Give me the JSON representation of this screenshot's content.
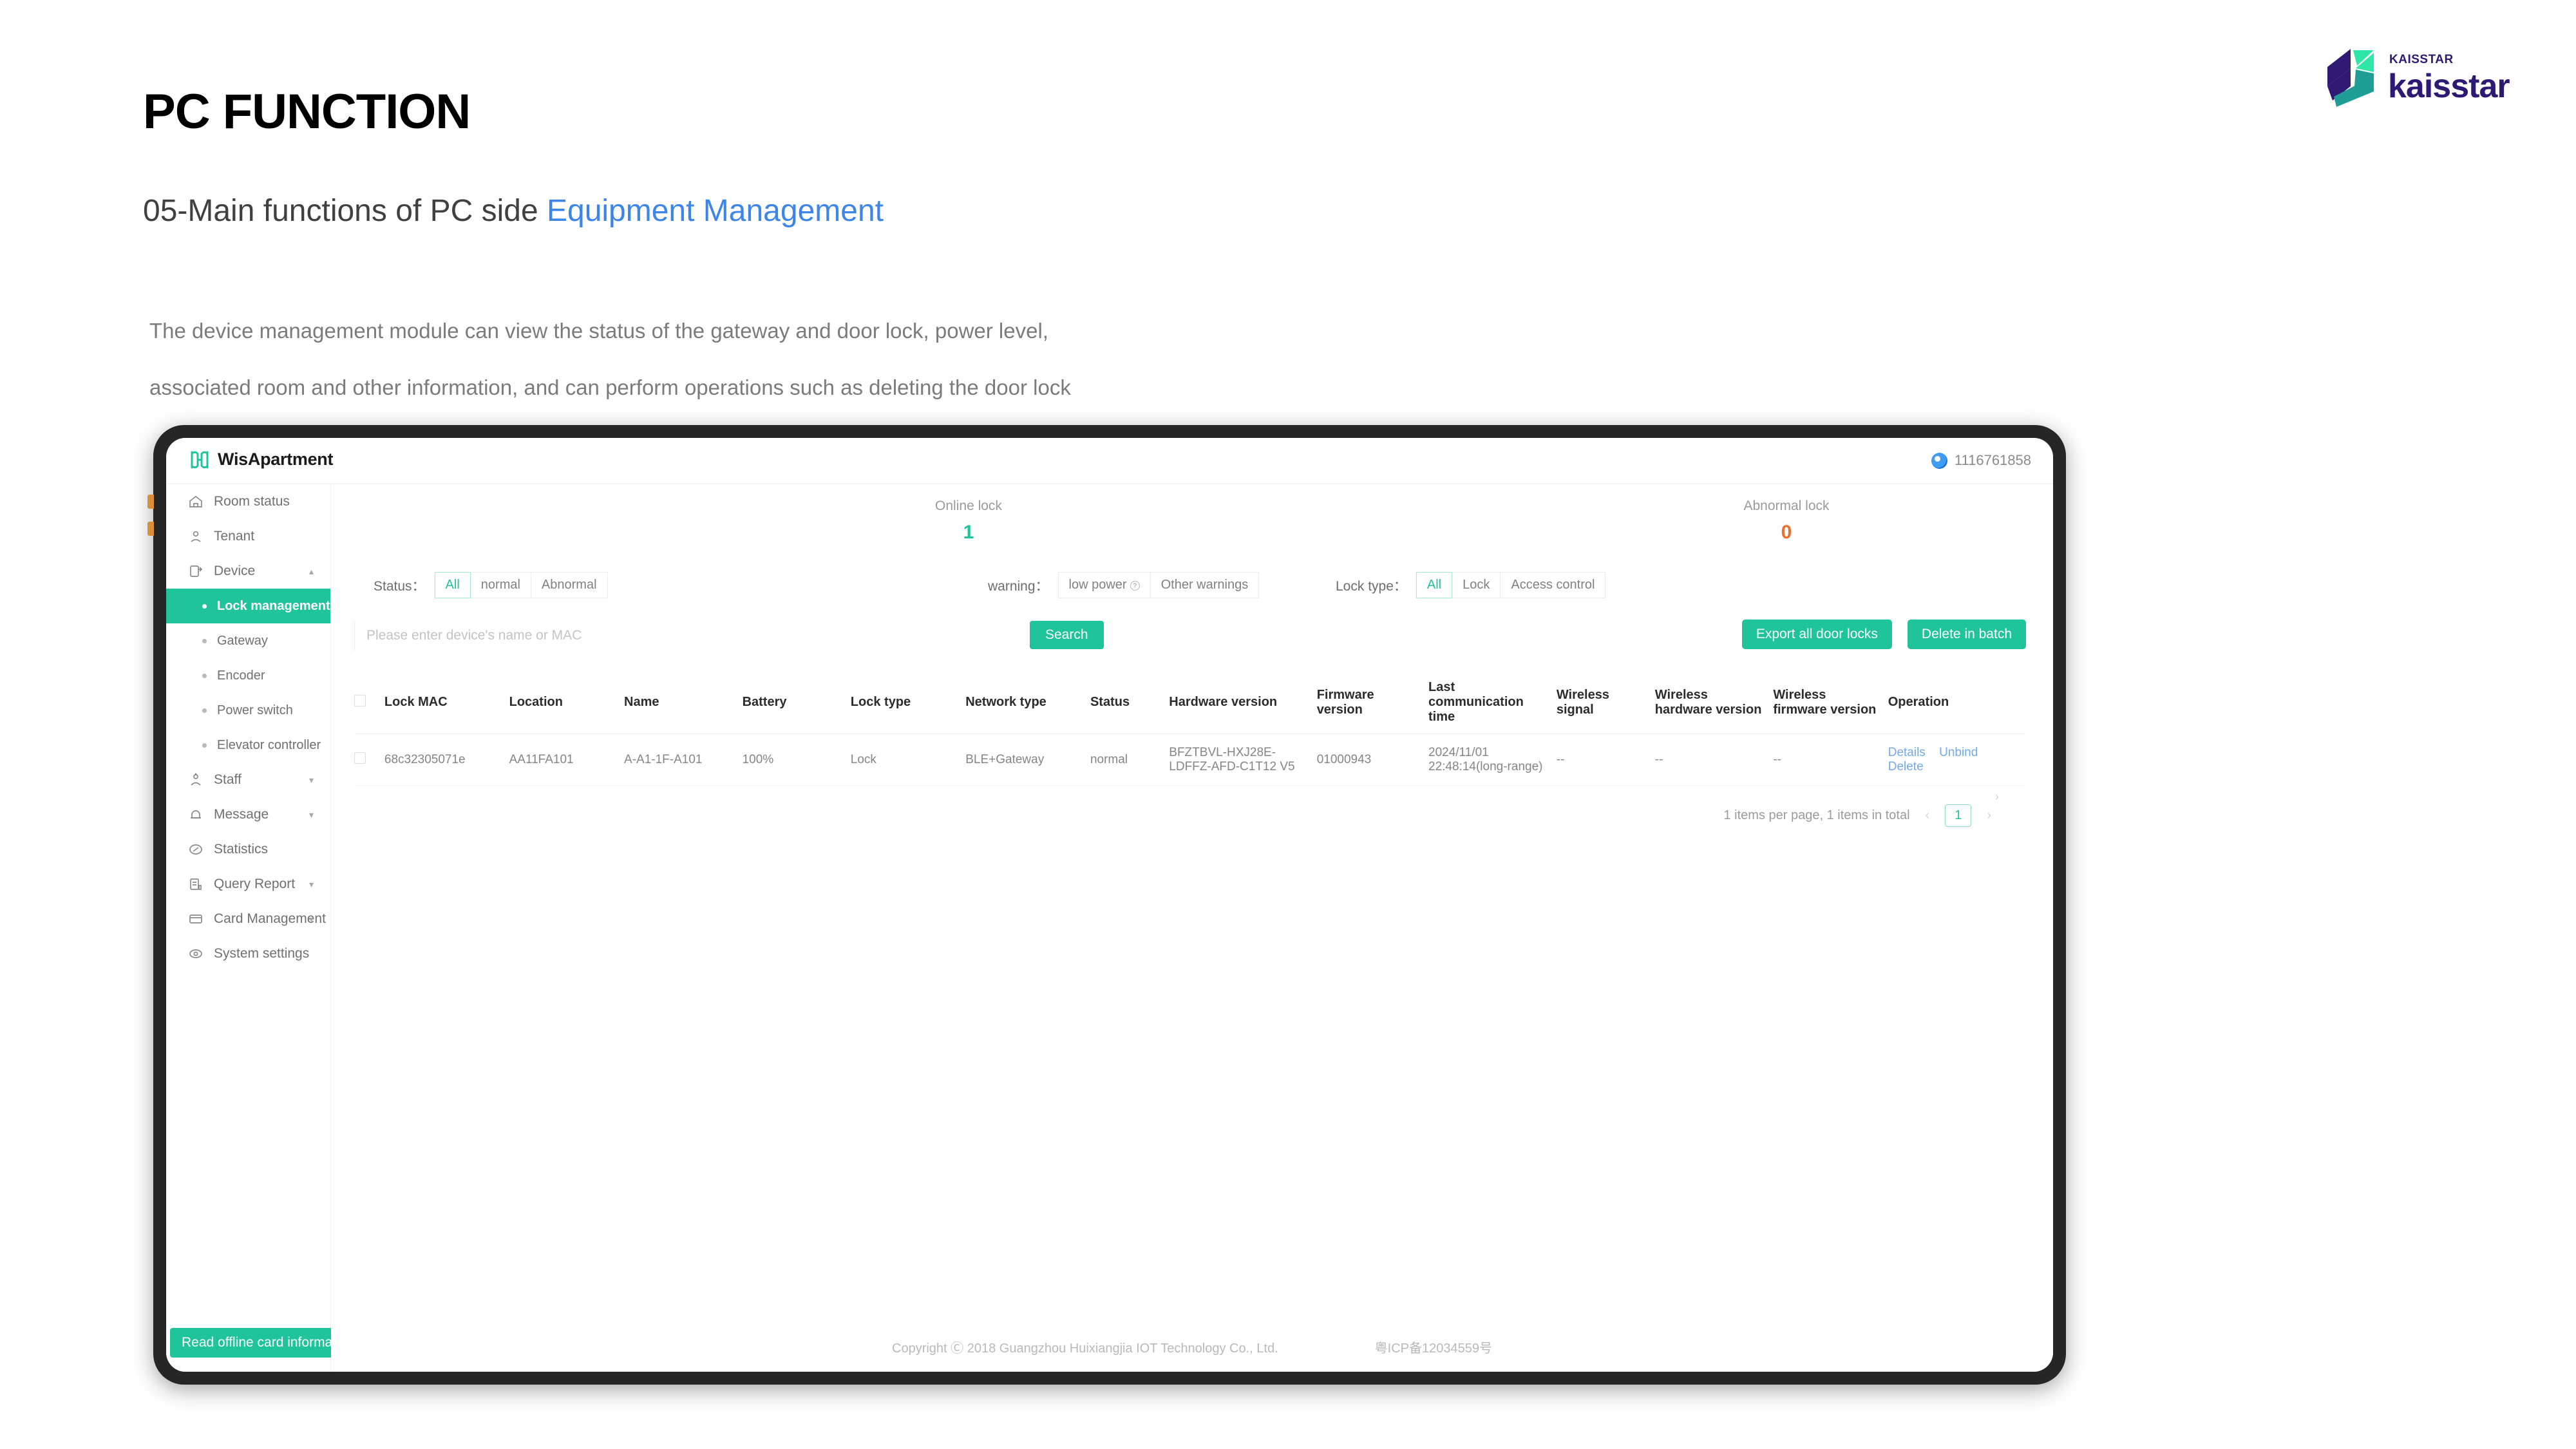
{
  "slide": {
    "title": "PC FUNCTION",
    "subtitle_plain": "05-Main functions of PC side ",
    "subtitle_accent": "Equipment Management",
    "desc_line1": "The device management module can view the status of the gateway and door lock, power level,",
    "desc_line2": "associated room and other information, and can perform operations such as deleting the door lock"
  },
  "logo": {
    "small_text": "KAISSTAR",
    "big_text": "kaisstar",
    "purple": "#2e1a75",
    "green": "#2ee6a8",
    "teal": "#1f9e96"
  },
  "app": {
    "brand": "WisApartment",
    "user_id": "1116761858",
    "accent": "#1fc49a"
  },
  "sidebar": {
    "items": [
      {
        "label": "Room status",
        "icon": "home-icon",
        "type": "top",
        "caret": ""
      },
      {
        "label": "Tenant",
        "icon": "user-icon",
        "type": "top",
        "caret": ""
      },
      {
        "label": "Device",
        "icon": "device-icon",
        "type": "top",
        "caret": "▴"
      },
      {
        "label": "Lock management",
        "icon": "dot-icon",
        "type": "sub",
        "active": true
      },
      {
        "label": "Gateway",
        "icon": "dot-icon",
        "type": "sub"
      },
      {
        "label": "Encoder",
        "icon": "dot-icon",
        "type": "sub"
      },
      {
        "label": "Power switch",
        "icon": "dot-icon",
        "type": "sub"
      },
      {
        "label": "Elevator controller",
        "icon": "dot-icon",
        "type": "sub"
      },
      {
        "label": "Staff",
        "icon": "staff-icon",
        "type": "top",
        "caret": "▾"
      },
      {
        "label": "Message",
        "icon": "bell-icon",
        "type": "top",
        "caret": "▾"
      },
      {
        "label": "Statistics",
        "icon": "chart-icon",
        "type": "top",
        "caret": ""
      },
      {
        "label": "Query Report",
        "icon": "report-icon",
        "type": "top",
        "caret": "▾"
      },
      {
        "label": "Card Management",
        "icon": "card-icon",
        "type": "top",
        "caret": "▾"
      },
      {
        "label": "System settings",
        "icon": "settings-icon",
        "type": "top",
        "caret": ""
      }
    ],
    "offline_button": "Read offline card information"
  },
  "stats": {
    "online": {
      "label": "Online lock",
      "value": "1",
      "color": "#1fc49a"
    },
    "abnormal": {
      "label": "Abnormal lock",
      "value": "0",
      "color": "#e8702a"
    }
  },
  "filters": {
    "status": {
      "label": "Status：",
      "options": [
        "All",
        "normal",
        "Abnormal"
      ],
      "selected": "All"
    },
    "warning": {
      "label": "warning：",
      "options": [
        "low power",
        "Other warnings"
      ],
      "selected": ""
    },
    "lock_type": {
      "label": "Lock type：",
      "options": [
        "All",
        "Lock",
        "Access control"
      ],
      "selected": "All"
    }
  },
  "search": {
    "placeholder": "Please enter device's name or MAC",
    "value": "",
    "button": "Search"
  },
  "toolbar": {
    "export_label": "Export all door locks",
    "delete_batch_label": "Delete in batch"
  },
  "table": {
    "columns": [
      "Lock MAC",
      "Location",
      "Name",
      "Battery",
      "Lock type",
      "Network type",
      "Status",
      "Hardware version",
      "Firmware version",
      "Last communication time",
      "Wireless signal",
      "Wireless hardware version",
      "Wireless firmware version",
      "Operation"
    ],
    "rows": [
      {
        "lock_mac": "68c32305071e",
        "location": "AA11FA101",
        "name": "A-A1-1F-A101",
        "battery": "100%",
        "lock_type": "Lock",
        "network_type": "BLE+Gateway",
        "status": "normal",
        "hardware_version": "BFZTBVL-HXJ28E-LDFFZ-AFD-C1T12 V5",
        "firmware_version": "01000943",
        "last_communication_time": "2024/11/01 22:48:14(long-range)",
        "wireless_signal": "--",
        "wireless_hardware_version": "--",
        "wireless_firmware_version": "--",
        "operations": [
          "Details",
          "Unbind",
          "Delete"
        ]
      }
    ]
  },
  "pagination": {
    "summary": "1 items per page, 1 items in total",
    "prev": "‹",
    "next": "›",
    "current_page": "1"
  },
  "footer": {
    "copyright": "Copyright Ⓒ 2018 Guangzhou Huixiangjia IOT Technology Co., Ltd.",
    "icp": "粤ICP备12034559号"
  }
}
